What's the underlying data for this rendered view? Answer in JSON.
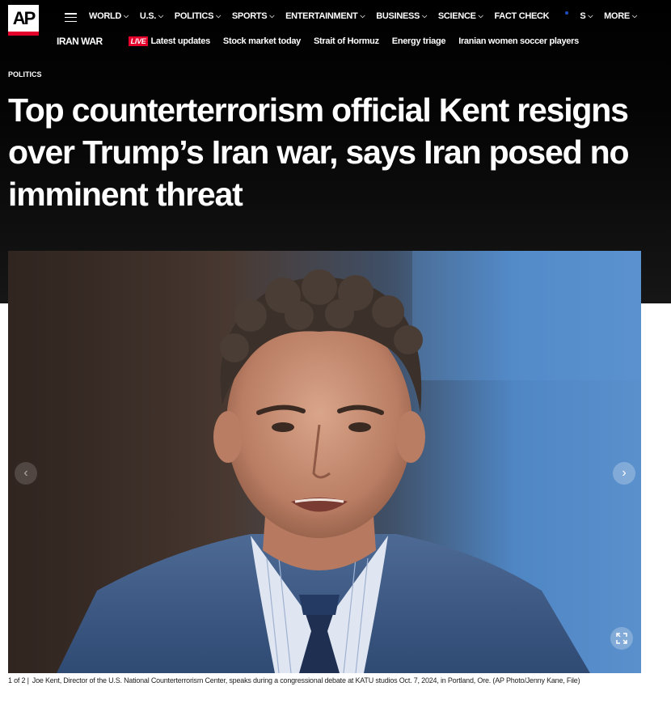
{
  "brand": {
    "logo_text": "AP",
    "accent": "#e4002b"
  },
  "nav": {
    "menu_icon": "hamburger-icon",
    "items": [
      {
        "label": "WORLD"
      },
      {
        "label": "U.S."
      },
      {
        "label": "POLITICS"
      },
      {
        "label": "SPORTS"
      },
      {
        "label": "ENTERTAINMENT"
      },
      {
        "label": "BUSINESS"
      },
      {
        "label": "SCIENCE"
      },
      {
        "label": "FACT CHECK"
      },
      {
        "label": "S"
      },
      {
        "label": "MORE"
      }
    ]
  },
  "subnav": {
    "title": "IRAN WAR",
    "live_badge": "LIVE",
    "links": [
      {
        "label": "Latest updates"
      },
      {
        "label": "Stock market today"
      },
      {
        "label": "Strait of Hormuz"
      },
      {
        "label": "Energy triage"
      },
      {
        "label": "Iranian women soccer players"
      }
    ]
  },
  "article": {
    "section": "POLITICS",
    "headline": "Top counterterrorism official Kent resigns over Trump’s Iran war, says Iran posed no imminent threat"
  },
  "gallery": {
    "counter": "1 of 2 |",
    "caption": "Joe Kent, Director of the U.S. National Counterterrorism Center, speaks during a congressional debate at KATU studios Oct. 7, 2024, in Portland, Ore. (AP Photo/Jenny Kane, File)",
    "prev_icon": "chevron-left-icon",
    "next_icon": "chevron-right-icon",
    "expand_icon": "expand-icon"
  }
}
